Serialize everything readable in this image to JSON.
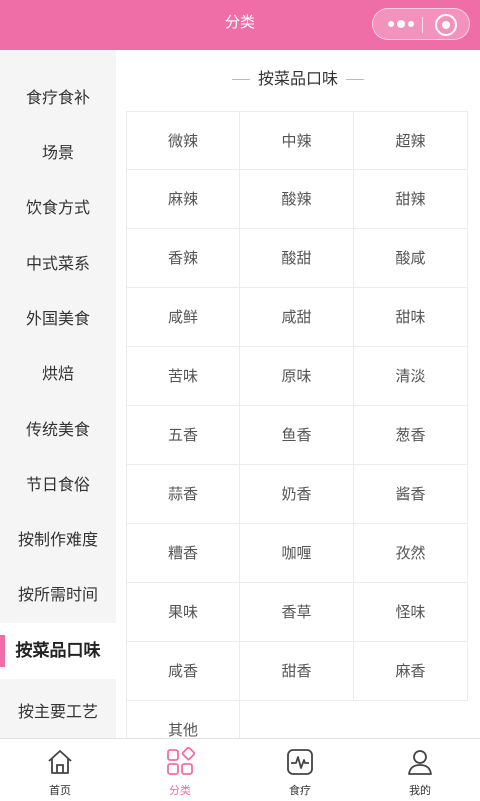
{
  "header": {
    "title": "分类"
  },
  "colors": {
    "accent": "#f06ea8",
    "sidebar_bg": "#f5f5f5"
  },
  "sidebar": {
    "items": [
      {
        "label": "食疗食补"
      },
      {
        "label": "场景"
      },
      {
        "label": "饮食方式"
      },
      {
        "label": "中式菜系"
      },
      {
        "label": "外国美食"
      },
      {
        "label": "烘焙"
      },
      {
        "label": "传统美食"
      },
      {
        "label": "节日食俗"
      },
      {
        "label": "按制作难度"
      },
      {
        "label": "按所需时间"
      },
      {
        "label": "按菜品口味",
        "active": true
      },
      {
        "label": "按主要工艺"
      }
    ]
  },
  "main": {
    "section_title": "按菜品口味",
    "items": [
      "微辣",
      "中辣",
      "超辣",
      "麻辣",
      "酸辣",
      "甜辣",
      "香辣",
      "酸甜",
      "酸咸",
      "咸鲜",
      "咸甜",
      "甜味",
      "苦味",
      "原味",
      "清淡",
      "五香",
      "鱼香",
      "葱香",
      "蒜香",
      "奶香",
      "酱香",
      "糟香",
      "咖喱",
      "孜然",
      "果味",
      "香草",
      "怪味",
      "咸香",
      "甜香",
      "麻香",
      "其他"
    ]
  },
  "tabbar": {
    "items": [
      {
        "label": "首页",
        "icon": "home-icon"
      },
      {
        "label": "分类",
        "icon": "category-icon",
        "active": true
      },
      {
        "label": "食疗",
        "icon": "heartbeat-icon"
      },
      {
        "label": "我的",
        "icon": "user-icon"
      }
    ]
  }
}
